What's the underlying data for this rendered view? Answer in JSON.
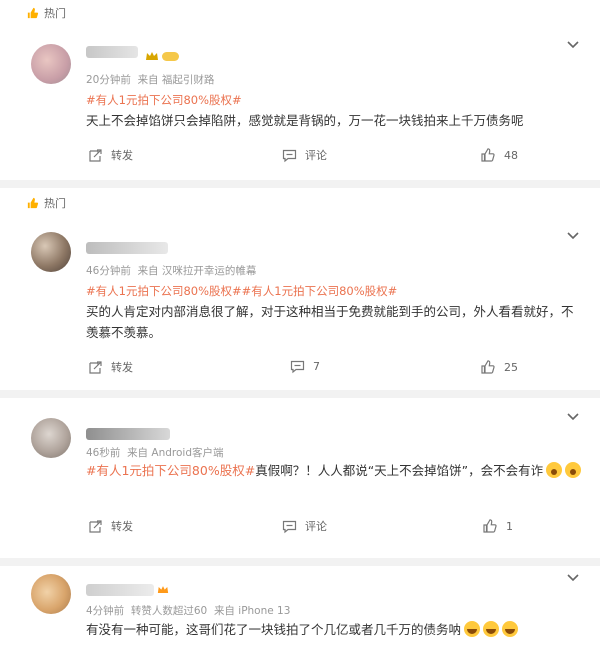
{
  "hot_label": "热门",
  "actions": {
    "repost": "转发",
    "comment": "评论"
  },
  "posts": [
    {
      "time": "20分钟前",
      "source_prefix": "来自",
      "source": "福起引财路",
      "hashtags": "#有人1元拍下公司80%股权#",
      "text": "天上不会掉馅饼只会掉陷阱，感觉就是背锅的，万一花一块钱拍来上千万债务呢",
      "likes": "48"
    },
    {
      "time": "46分钟前",
      "source_prefix": "来自",
      "source": "汉咪拉开幸运的帷幕",
      "hashtags": "#有人1元拍下公司80%股权##有人1元拍下公司80%股权#",
      "text": "买的人肯定对内部消息很了解，对于这种相当于免费就能到手的公司，外人看看就好，不羡慕不羡慕。",
      "comments": "7",
      "likes": "25"
    },
    {
      "time": "46秒前",
      "source_prefix": "来自",
      "source": "Android客户端",
      "tag": "#有人1元拍下公司80%股权#",
      "text": "真假啊？！人人都说“天上不会掉馅饼”，会不会有诈",
      "likes": "1"
    },
    {
      "time": "4分钟前",
      "extra": "转赞人数超过60",
      "source_prefix": "来自",
      "source": "iPhone 13",
      "text": "有没有一种可能，这哥们花了一块钱拍了个几亿或者几千万的债务呐"
    }
  ],
  "icons": {
    "hot": "hot-thumb-icon",
    "chevron": "chevron-down-icon",
    "repost": "repost-icon",
    "comment": "comment-icon",
    "like": "like-icon",
    "emoji_wow": "surprised-emoji",
    "emoji_laugh": "laugh-emoji"
  },
  "colors": {
    "tag": "#eb7350",
    "meta": "#999999",
    "separator": "#f2f2f2"
  }
}
